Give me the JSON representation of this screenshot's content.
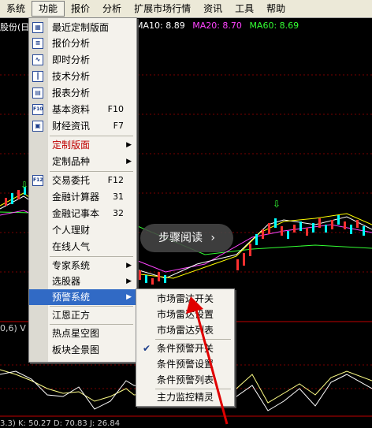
{
  "menubar": {
    "items": [
      {
        "label": "系统"
      },
      {
        "label": "功能"
      },
      {
        "label": "报价"
      },
      {
        "label": "分析"
      },
      {
        "label": "扩展市场行情"
      },
      {
        "label": "资讯"
      },
      {
        "label": "工具"
      },
      {
        "label": "帮助"
      }
    ],
    "active_index": 1
  },
  "stock": {
    "title": "股份(日"
  },
  "ma_legend": {
    "ma10": "MA10: 8.89",
    "ma20": "MA20: 8.70",
    "ma60": "MA60: 8.69",
    "colors": {
      "ma10": "#ffffff",
      "ma20": "#ff44ff",
      "ma60": "#33ff33"
    }
  },
  "indicator": {
    "title": "0,6) V",
    "readout": "3.3)  K: 50.27  D: 70.83  J: 26.84"
  },
  "function_menu": {
    "items": [
      {
        "label": "最近定制版面",
        "icon": "layout-icon"
      },
      {
        "label": "报价分析",
        "icon": "quote-table-icon"
      },
      {
        "label": "即时分析",
        "icon": "intraday-chart-icon"
      },
      {
        "label": "技术分析",
        "icon": "candlestick-icon"
      },
      {
        "label": "报表分析",
        "icon": "report-icon"
      },
      {
        "label": "基本资料",
        "icon": "f10-icon",
        "shortcut": "F10"
      },
      {
        "label": "财经资讯",
        "icon": "news-icon",
        "shortcut": "F7"
      },
      {
        "label": "定制版面",
        "submenu": true
      },
      {
        "label": "定制品种",
        "submenu": true
      },
      {
        "label": "交易委托",
        "icon": "f12-icon",
        "shortcut": "F12"
      },
      {
        "label": "金融计算器",
        "shortcut": "31"
      },
      {
        "label": "金融记事本",
        "shortcut": "32"
      },
      {
        "label": "个人理财"
      },
      {
        "label": "在线人气"
      },
      {
        "label": "专家系统",
        "submenu": true
      },
      {
        "label": "选股器",
        "submenu": true
      },
      {
        "label": "预警系统",
        "submenu": true
      },
      {
        "label": "江恩正方"
      },
      {
        "label": "热点星空图"
      },
      {
        "label": "板块全景图"
      }
    ],
    "icon_text": {
      "f10": "F10",
      "f12": "F12"
    }
  },
  "warning_submenu": {
    "items": [
      {
        "label": "市场雷达开关"
      },
      {
        "label": "市场雷达设置"
      },
      {
        "label": "市场雷达列表"
      },
      {
        "label": "条件预警开关",
        "checked": true
      },
      {
        "label": "条件预警设置"
      },
      {
        "label": "条件预警列表"
      },
      {
        "label": "主力监控精灵"
      }
    ]
  },
  "overlay": {
    "label": "步骤阅读"
  },
  "colors": {
    "menu_highlight": "#316ac5",
    "custom_layout_text": "#c00000",
    "arrow_annotation": "#e00000"
  }
}
